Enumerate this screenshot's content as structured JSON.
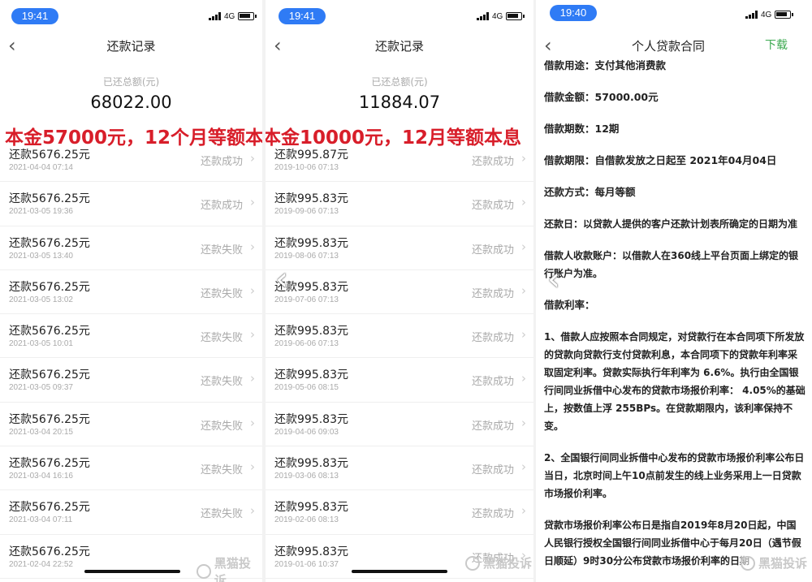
{
  "screens": [
    {
      "status_time": "19:41",
      "network": "4G",
      "title": "还款记录",
      "total_label": "已还总额(元)",
      "total_value": "68022.00",
      "annotation": "本金57000元，12个月等额本息",
      "items": [
        {
          "title": "还款5676.25元",
          "date": "2021-04-04 07:14",
          "status": "还款成功"
        },
        {
          "title": "还款5676.25元",
          "date": "2021-03-05 19:36",
          "status": "还款成功"
        },
        {
          "title": "还款5676.25元",
          "date": "2021-03-05 13:40",
          "status": "还款失败"
        },
        {
          "title": "还款5676.25元",
          "date": "2021-03-05 13:02",
          "status": "还款失败"
        },
        {
          "title": "还款5676.25元",
          "date": "2021-03-05 10:01",
          "status": "还款失败"
        },
        {
          "title": "还款5676.25元",
          "date": "2021-03-05 09:37",
          "status": "还款失败"
        },
        {
          "title": "还款5676.25元",
          "date": "2021-03-04 20:15",
          "status": "还款失败"
        },
        {
          "title": "还款5676.25元",
          "date": "2021-03-04 16:16",
          "status": "还款失败"
        },
        {
          "title": "还款5676.25元",
          "date": "2021-03-04 07:11",
          "status": "还款失败"
        },
        {
          "title": "还款5676.25元",
          "date": "2021-02-04 22:52",
          "status": ""
        }
      ]
    },
    {
      "status_time": "19:41",
      "network": "4G",
      "title": "还款记录",
      "total_label": "已还总额(元)",
      "total_value": "11884.07",
      "annotation": "本金10000元，12月等额本息",
      "items": [
        {
          "title": "还款995.87元",
          "date": "2019-10-06 07:13",
          "status": "还款成功"
        },
        {
          "title": "还款995.83元",
          "date": "2019-09-06 07:13",
          "status": "还款成功"
        },
        {
          "title": "还款995.83元",
          "date": "2019-08-06 07:13",
          "status": "还款成功"
        },
        {
          "title": "还款995.83元",
          "date": "2019-07-06 07:13",
          "status": "还款成功"
        },
        {
          "title": "还款995.83元",
          "date": "2019-06-06 07:13",
          "status": "还款成功"
        },
        {
          "title": "还款995.83元",
          "date": "2019-05-06 08:15",
          "status": "还款成功"
        },
        {
          "title": "还款995.83元",
          "date": "2019-04-06 09:03",
          "status": "还款成功"
        },
        {
          "title": "还款995.83元",
          "date": "2019-03-06 08:13",
          "status": "还款成功"
        },
        {
          "title": "还款995.83元",
          "date": "2019-02-06 08:13",
          "status": "还款成功"
        },
        {
          "title": "还款995.83元",
          "date": "2019-01-06 10:37",
          "status": "还款成功"
        }
      ]
    }
  ],
  "contract_screen": {
    "status_time": "19:40",
    "network": "4G",
    "title": "个人贷款合同",
    "action": "下载",
    "lines": [
      "借款用途：支付其他消费款",
      "借款金额：57000.00元",
      "借款期数：12期",
      "借款期限：自借款发放之日起至 2021年04月04日",
      "还款方式：每月等额",
      "还款日：以贷款人提供的客户还款计划表所确定的日期为准",
      "借款人收款账户：以借款人在360线上平台页面上绑定的银行账户为准。",
      "借款利率：",
      "1、借款人应按照本合同规定，对贷款行在本合同项下所发放的贷款向贷款行支付贷款利息，本合同项下的贷款年利率采取固定利率。贷款实际执行年利率为 6.6%。执行由全国银行间同业拆借中心发布的贷款市场报价利率： 4.05%的基础上，按数值上浮 255BPs。在贷款期限内，该利率保持不变。",
      "2、全国银行间同业拆借中心发布的贷款市场报价利率公布日当日，北京时间上午10点前发生的线上业务采用上一日贷款市场报价利率。",
      "贷款市场报价利率公布日是指自2019年8月20日起，中国人民银行授权全国银行间同业拆借中心于每月20日（遇节假日顺延）9时30分公布贷款市场报价利率的日期"
    ]
  },
  "watermark": "黑猫投诉",
  "icons": {
    "back": "chevron-left-icon",
    "row": "chevron-right-icon"
  }
}
